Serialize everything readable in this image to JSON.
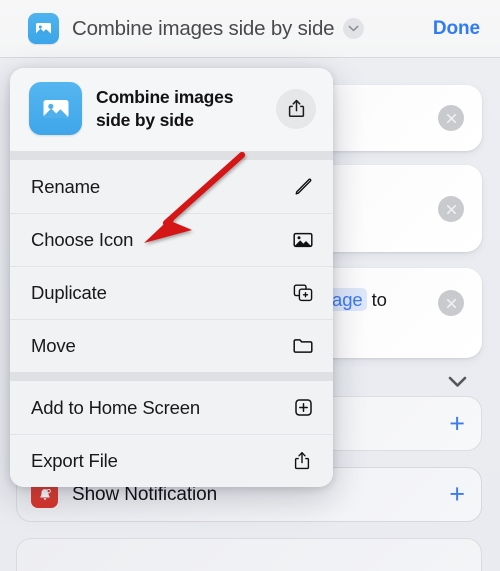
{
  "navbar": {
    "app_icon": "photo-icon",
    "title": "Combine images side by side",
    "chevron_icon": "chevron-down-icon",
    "done_label": "Done"
  },
  "context_menu": {
    "header": {
      "icon": "photo-icon",
      "title": "Combine images side by side",
      "share_icon": "share-icon",
      "share_label": "Share"
    },
    "groups": [
      {
        "items": [
          {
            "label": "Rename",
            "icon": "pencil-icon"
          },
          {
            "label": "Choose Icon",
            "icon": "photo-icon"
          },
          {
            "label": "Duplicate",
            "icon": "duplicate-plus-icon"
          },
          {
            "label": "Move",
            "icon": "folder-icon"
          }
        ]
      },
      {
        "items": [
          {
            "label": "Add to Home Screen",
            "icon": "plus-square-icon"
          },
          {
            "label": "Export File",
            "icon": "share-icon"
          }
        ]
      }
    ]
  },
  "background": {
    "cards": [
      {
        "name": "action-card-1",
        "clear_icon": "close-circle-icon"
      },
      {
        "name": "action-card-2",
        "clear_icon": "close-circle-icon"
      },
      {
        "name": "action-card-3",
        "clear_icon": "close-circle-icon",
        "token_text": "age",
        "trailing_text": "to"
      }
    ],
    "collapse_icon": "chevron-down-icon",
    "add_row": {
      "plus_icon": "plus-icon"
    },
    "notification_row": {
      "icon": "bell-badge-icon",
      "label": "Show Notification",
      "plus_icon": "plus-icon"
    }
  },
  "annotation": {
    "arrow_color": "#d41616",
    "arrow_target": "Choose Icon"
  },
  "colors": {
    "accent_blue": "#3d7bf0",
    "done_blue": "#2f7cf6",
    "app_icon_blue": "#3fa6e9",
    "notification_red": "#d8342c",
    "arrow_red": "#d41616",
    "menu_bg": "#f1f2f4",
    "page_bg": "#eceef2"
  }
}
